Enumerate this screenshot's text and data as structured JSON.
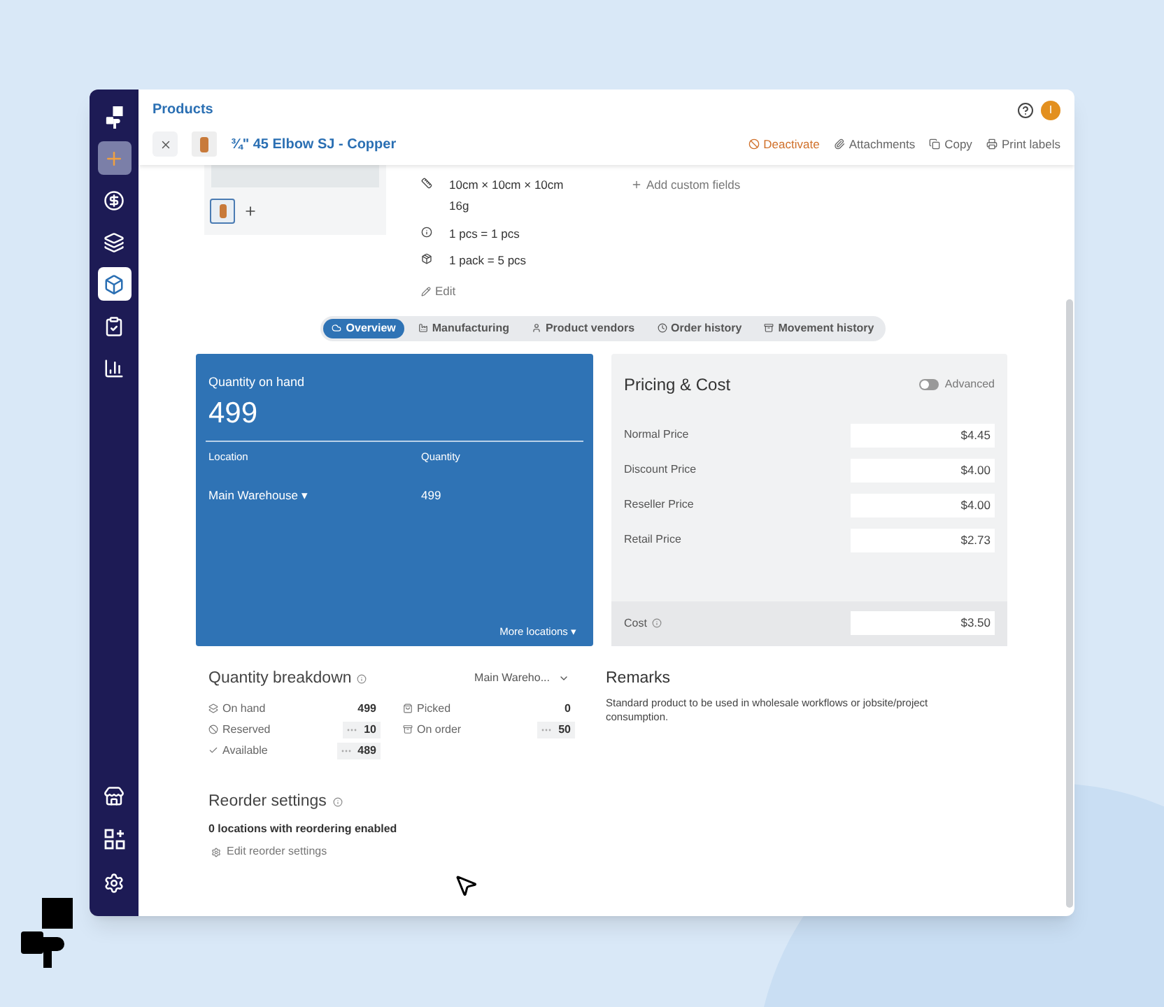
{
  "sidebar": {
    "items": [
      {
        "kind": "action",
        "selected": false
      },
      {
        "kind": "nav",
        "selected": false
      },
      {
        "kind": "nav",
        "selected": false
      },
      {
        "kind": "nav",
        "selected": true
      },
      {
        "kind": "nav",
        "selected": false
      },
      {
        "kind": "nav",
        "selected": false
      }
    ],
    "bottom_items": [
      {
        "selected": false
      },
      {
        "selected": false
      },
      {
        "selected": false
      }
    ]
  },
  "header": {
    "title": "Products",
    "avatar": "I"
  },
  "product": {
    "title": "¾\" 45 Elbow SJ - Copper",
    "actions": [
      {
        "label": "Deactivate",
        "kind": "danger"
      },
      {
        "label": "Attachments",
        "kind": "normal"
      },
      {
        "label": "Copy",
        "kind": "normal"
      },
      {
        "label": "Print labels",
        "kind": "normal"
      }
    ]
  },
  "thumbnails": [
    {
      "selected": true
    }
  ],
  "details": [
    {
      "lines": [
        "10cm × 10cm × 10cm",
        "16g"
      ]
    },
    {
      "lines": [
        "1 pcs = 1 pcs"
      ]
    },
    {
      "lines": [
        "1 pack = 5 pcs"
      ]
    }
  ],
  "edit_link": "Edit",
  "add_custom_fields": "Add custom fields",
  "tabs": [
    {
      "label": "Overview",
      "selected": true
    },
    {
      "label": "Manufacturing",
      "selected": false
    },
    {
      "label": "Product vendors",
      "selected": false
    },
    {
      "label": "Order history",
      "selected": false
    },
    {
      "label": "Movement history",
      "selected": false
    }
  ],
  "stock": {
    "title": "Quantity on hand",
    "total": "499",
    "columns": [
      "Location",
      "Quantity"
    ],
    "rows": [
      {
        "location": "Main Warehouse ▾",
        "quantity": "499"
      }
    ],
    "more": "More locations ▾"
  },
  "pricing": {
    "title": "Pricing & Cost",
    "advanced": {
      "label": "Advanced",
      "on": false
    },
    "prices": [
      {
        "label": "Normal Price",
        "value": "$4.45"
      },
      {
        "label": "Discount Price",
        "value": "$4.00"
      },
      {
        "label": "Reseller Price",
        "value": "$4.00"
      },
      {
        "label": "Retail Price",
        "value": "$2.73"
      }
    ],
    "cost": {
      "label": "Cost",
      "value": "$3.50"
    }
  },
  "breakdown": {
    "title": "Quantity breakdown",
    "location": "Main Wareho...",
    "items": [
      {
        "label": "On hand",
        "value": "499",
        "boxed": false
      },
      {
        "label": "Picked",
        "value": "0",
        "boxed": false
      },
      {
        "label": "Reserved",
        "value": "10",
        "boxed": true
      },
      {
        "label": "On order",
        "value": "50",
        "boxed": true
      },
      {
        "label": "Available",
        "value": "489",
        "boxed": true
      }
    ]
  },
  "remarks": {
    "title": "Remarks",
    "text": "Standard product to be used in wholesale workflows or jobsite/project consumption."
  },
  "reorder": {
    "title": "Reorder settings",
    "summary": "0 locations with reordering enabled",
    "edit": "Edit reorder settings"
  }
}
